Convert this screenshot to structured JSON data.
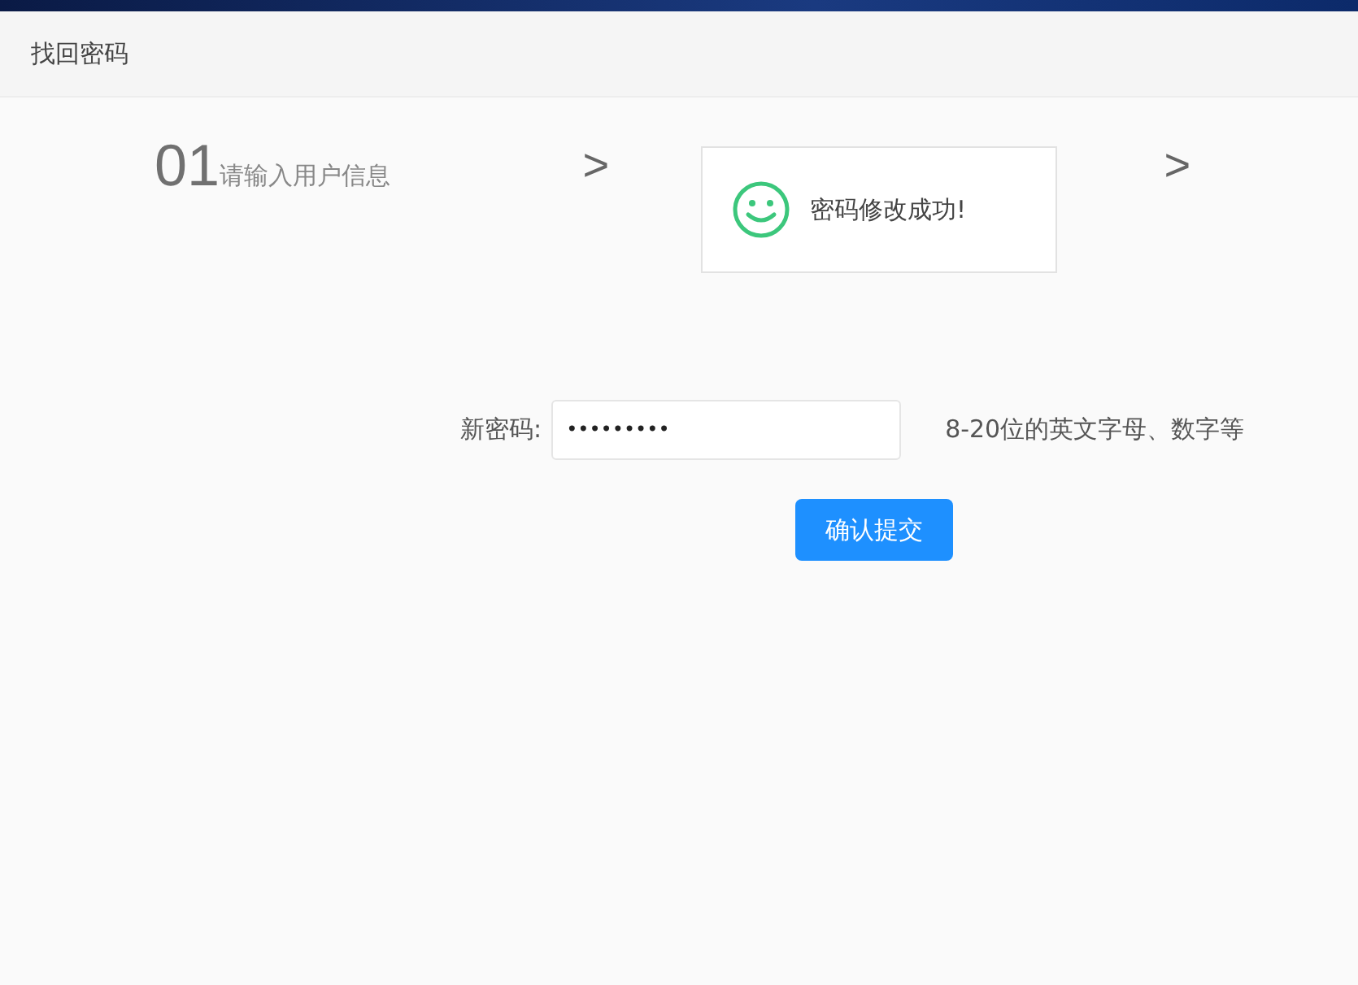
{
  "header": {
    "title": "找回密码"
  },
  "steps": [
    {
      "number": "01",
      "label": "请输入用户信息"
    }
  ],
  "step_separators": [
    ">",
    ">"
  ],
  "toast": {
    "kind": "success",
    "message": "密码修改成功!"
  },
  "form": {
    "label": "新密码:",
    "value": "•••••••••",
    "hint": "8-20位的英文字母、数字等"
  },
  "submit_button": {
    "label": "确认提交"
  }
}
